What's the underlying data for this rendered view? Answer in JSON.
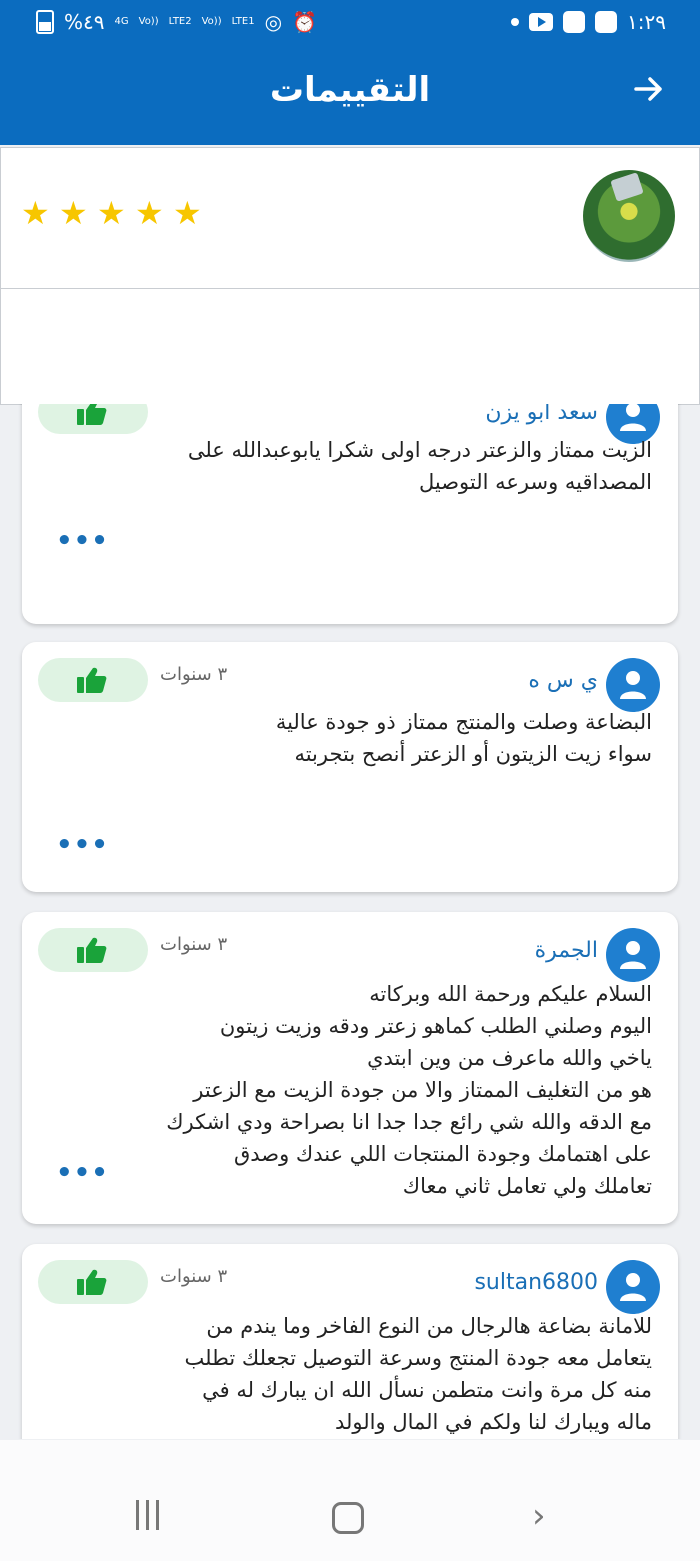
{
  "status_bar": {
    "battery": "%٤٩",
    "network_labels": [
      "4G",
      "Vo))",
      "LTE2",
      "Vo))",
      "LTE1"
    ],
    "time": "١:٢٩"
  },
  "app_bar": {
    "title": "التقييمات",
    "back_icon": "arrow-right-icon"
  },
  "product": {
    "rating_stars": 5,
    "star_color": "#f7c600"
  },
  "reviews": [
    {
      "author": "سعد أبو يزن",
      "body": "الزيت ممتاز والزعتر درجه اولى شكرا يابوعبدالله على\nالمصداقيه وسرعه التوصيل",
      "more": "•••"
    },
    {
      "author": "ي س ه",
      "age": "٣ سنوات",
      "body": "البضاعة وصلت والمنتج ممتاز ذو جودة عالية\nسواء زيت الزيتون أو الزعتر أنصح بتجربته",
      "more": "•••"
    },
    {
      "author": "الجمرة",
      "age": "٣ سنوات",
      "body": "السلام عليكم ورحمة الله وبركاته\nاليوم وصلني الطلب كماهو زعتر ودقه وزيت زيتون\nياخي والله ماعرف من وين ابتدي\nهو من التغليف الممتاز والا من جودة الزيت مع الزعتر\nمع الدقه والله شي رائع جدا جدا انا بصراحة ودي اشكرك\nعلى اهتمامك وجودة المنتجات اللي عندك وصدق\nتعاملك ولي تعامل ثاني معاك",
      "more": "•••"
    },
    {
      "author": "sultan6800",
      "age": "٣ سنوات",
      "body": "للامانة بضاعة هالرجال من النوع الفاخر وما يندم من\nيتعامل معه جودة المنتج وسرعة التوصيل تجعلك تطلب\nمنه كل مرة وانت متطمن نسأل الله ان يبارك له في\nماله ويبارك لنا ولكم في المال والولد"
    }
  ],
  "colors": {
    "primary": "#0b6cbf",
    "like_bg": "#dff3e3",
    "like_icon": "#1aa33a",
    "link": "#1a6fb6"
  }
}
